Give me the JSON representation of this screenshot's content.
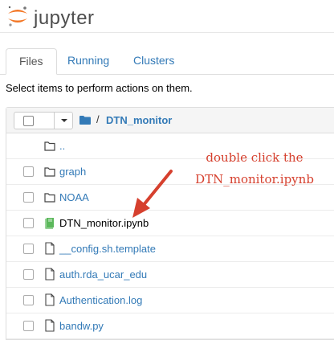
{
  "app": {
    "logo_text": "jupyter"
  },
  "tabs": [
    {
      "label": "Files",
      "active": true
    },
    {
      "label": "Running",
      "active": false
    },
    {
      "label": "Clusters",
      "active": false
    }
  ],
  "instructions": "Select items to perform actions on them.",
  "breadcrumb": {
    "separator": "/",
    "folder": "DTN_monitor"
  },
  "files": [
    {
      "name": "..",
      "type": "folder",
      "has_checkbox": false
    },
    {
      "name": "graph",
      "type": "folder",
      "has_checkbox": true
    },
    {
      "name": "NOAA",
      "type": "folder",
      "has_checkbox": true
    },
    {
      "name": "DTN_monitor.ipynb",
      "type": "notebook",
      "has_checkbox": true
    },
    {
      "name": "__config.sh.template",
      "type": "file",
      "has_checkbox": true
    },
    {
      "name": "auth.rda_ucar_edu",
      "type": "file",
      "has_checkbox": true
    },
    {
      "name": "Authentication.log",
      "type": "file",
      "has_checkbox": true
    },
    {
      "name": "bandw.py",
      "type": "file",
      "has_checkbox": true
    }
  ],
  "annotation": {
    "line1": "double click the",
    "line2": "DTN_monitor.ipynb",
    "color": "#d6402e"
  },
  "colors": {
    "link": "#337ab7",
    "notebook_icon": "#5cb85c",
    "logo_orange": "#f37726"
  }
}
